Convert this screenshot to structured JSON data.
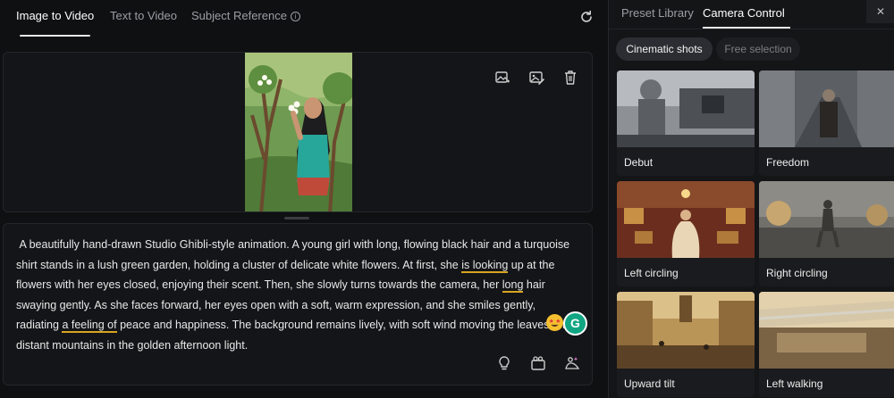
{
  "tabs": {
    "image_to_video": "Image to Video",
    "text_to_video": "Text to Video",
    "subject_reference": "Subject Reference"
  },
  "prompt": {
    "p1": " A beautifully hand-drawn Studio Ghibli-style animation. A young girl with long, flowing black hair and a turquoise shirt stands in a lush green garden, holding a cluster of delicate white flowers. At first, she ",
    "u1": "is looking",
    "p2": " up at the flowers with her eyes closed, enjoying their scent. Then, she slowly turns towards the camera, her ",
    "u2": "long",
    "p3": " hair swaying gently. As she faces forward, her eyes open with a soft, warm expression, and she smiles gently, radiating ",
    "u3": "a feeling of",
    "p4": " peace and happiness. The background remains lively, with soft wind moving the leaves and distant mountains in the golden afternoon light."
  },
  "grammar_badge": "G",
  "right_panel": {
    "tabs": {
      "preset_library": "Preset Library",
      "camera_control": "Camera Control"
    },
    "close": "✕",
    "filters": {
      "cinematic": "Cinematic shots",
      "free": "Free selection"
    },
    "cards": [
      {
        "label": "Debut"
      },
      {
        "label": "Freedom"
      },
      {
        "label": "Left circling"
      },
      {
        "label": "Right circling"
      },
      {
        "label": "Upward tilt"
      },
      {
        "label": "Left walking"
      }
    ]
  },
  "colors": {
    "accent_underline": "#d9a521",
    "grammar_green": "#11a683",
    "panel_bg": "#141518",
    "page_bg": "#0e0f11"
  }
}
